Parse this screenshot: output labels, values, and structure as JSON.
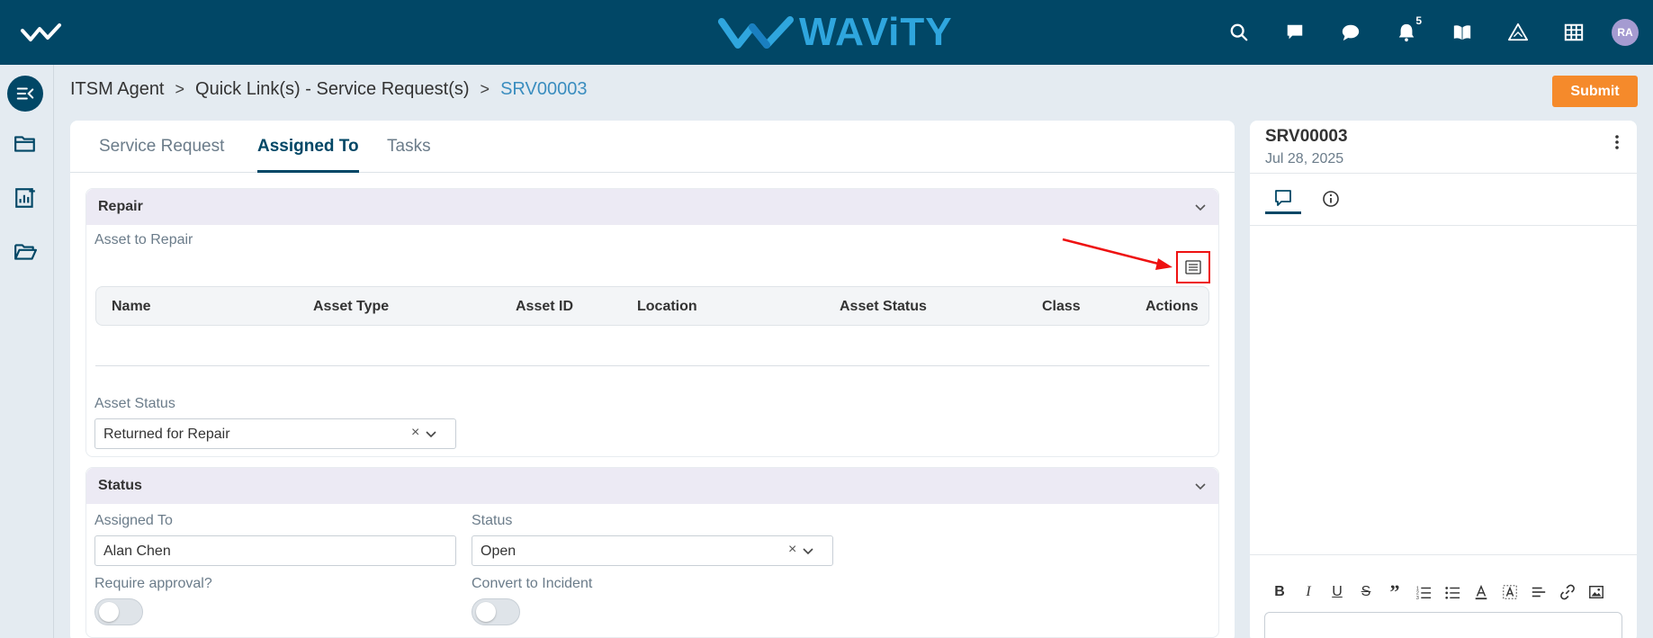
{
  "header": {
    "brand": "WAViTY",
    "notification_count": "5",
    "avatar_initials": "RA",
    "icons": [
      "search-icon",
      "note-icon",
      "chat-icon",
      "bell-icon",
      "book-icon",
      "warning-icon",
      "grid-icon"
    ]
  },
  "sidebar": {
    "items": [
      "collapse-menu-icon",
      "folder-icon",
      "report-icon",
      "folder-open-icon"
    ]
  },
  "breadcrumb": {
    "items": [
      "ITSM Agent",
      "Quick Link(s) - Service Request(s)",
      "SRV00003"
    ],
    "separator": ">"
  },
  "submit_label": "Submit",
  "tabs": [
    "Service Request",
    "Assigned To",
    "Tasks"
  ],
  "repair": {
    "title": "Repair",
    "asset_to_repair_label": "Asset to Repair",
    "columns": [
      "Name",
      "Asset Type",
      "Asset ID",
      "Location",
      "Asset Status",
      "Class",
      "Actions"
    ],
    "asset_status_label": "Asset Status",
    "asset_status_value": "Returned for Repair"
  },
  "status": {
    "title": "Status",
    "assigned_to_label": "Assigned To",
    "assigned_to_value": "Alan Chen",
    "status_label": "Status",
    "status_value": "Open",
    "require_approval_label": "Require approval?",
    "convert_incident_label": "Convert to Incident"
  },
  "right_panel": {
    "title": "SRV00003",
    "date": "Jul 28, 2025"
  },
  "editor_toolbar": [
    "B",
    "I",
    "U",
    "S",
    "”"
  ],
  "colors": {
    "header": "#014766",
    "brand": "#2fa6de",
    "submit": "#f58a2b",
    "breadcrumb_current": "#3a8dbf",
    "highlight": "#ee1111"
  }
}
